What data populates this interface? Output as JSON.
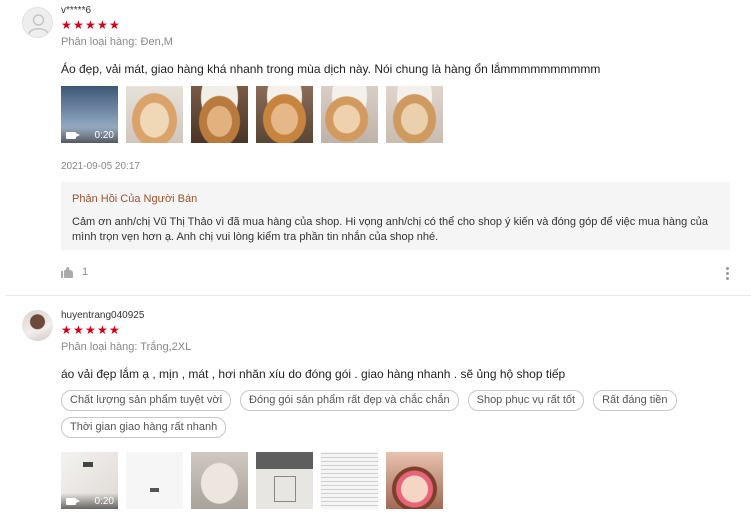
{
  "colors": {
    "star": "#d0011b",
    "reply_title": "#a0522d",
    "muted": "#888888"
  },
  "reviews": [
    {
      "username": "v*****6",
      "variant": "Phân loại hàng: Đen,M",
      "comment": "Áo đẹp, vải mát, giao hàng khá nhanh trong mùa dịch này. Nói chung là hàng ổn lắmmmmmmmmmm",
      "rating": 5,
      "video_duration": "0:20",
      "timestamp": "2021-09-05 20:17",
      "reply": {
        "title": "Phản Hồi Của Người Bán",
        "text": "Cảm ơn anh/chị Vũ Thị Thảo vì đã mua hàng của shop. Hi vọng anh/chị có thể cho shop ý kiến và đóng góp để việc mua hàng của mình trọn vẹn hơn ạ. Anh chị vui lòng kiểm tra phần tin nhắn của shop nhé."
      },
      "likes": "1"
    },
    {
      "username": "huyentrang040925",
      "variant": "Phân loại hàng: Trắng,2XL",
      "comment": "áo vải đẹp lắm ạ , mịn , mát , hơi nhăn xíu do đóng gói . giao hàng nhanh . sẽ ủng hộ shop tiếp",
      "rating": 5,
      "tags": [
        "Chất lượng sản phẩm tuyệt vời",
        "Đóng gói sản phẩm rất đẹp và chắc chắn",
        "Shop phục vụ rất tốt",
        "Rất đáng tiền",
        "Thời gian giao hàng rất nhanh"
      ],
      "video_duration": "0:20"
    }
  ],
  "icons": [
    "user-avatar-icon",
    "star-icon",
    "video-camera-icon",
    "thumbs-up-icon",
    "more-vertical-icon"
  ]
}
